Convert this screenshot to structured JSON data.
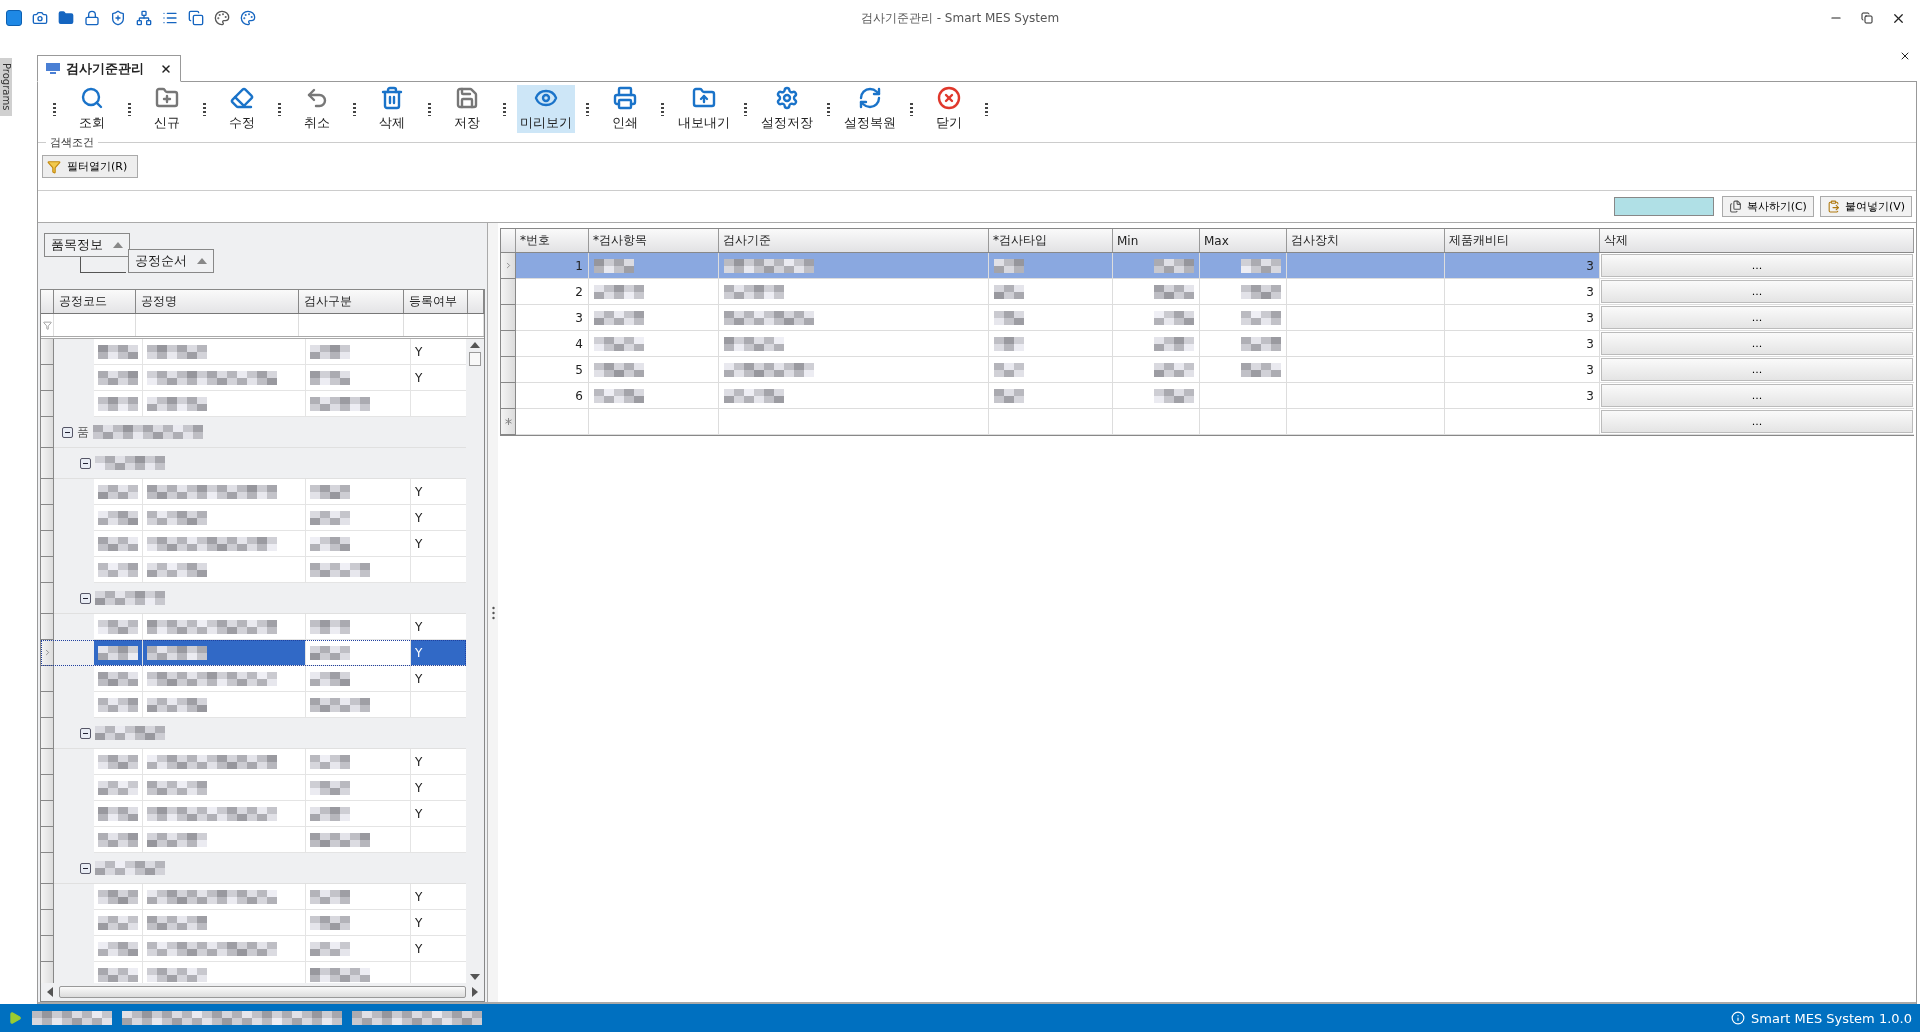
{
  "app_bar": {
    "title": "검사기준관리 - Smart MES System"
  },
  "side_tab": {
    "label": "Programs"
  },
  "document_tab": {
    "label": "검사기준관리",
    "selected": true
  },
  "toolbar": [
    {
      "kind": "search",
      "label": "조회",
      "selected": false
    },
    {
      "kind": "new",
      "label": "신규",
      "selected": false
    },
    {
      "kind": "edit",
      "label": "수정",
      "selected": false
    },
    {
      "kind": "cancel",
      "label": "취소",
      "selected": false
    },
    {
      "kind": "delete",
      "label": "삭제",
      "selected": false
    },
    {
      "kind": "save",
      "label": "저장",
      "selected": false
    },
    {
      "kind": "preview",
      "label": "미리보기",
      "selected": true
    },
    {
      "kind": "print",
      "label": "인쇄",
      "selected": false
    },
    {
      "kind": "export",
      "label": "내보내기",
      "selected": false
    },
    {
      "kind": "settings-save",
      "label": "설정저장",
      "selected": false
    },
    {
      "kind": "settings-restore",
      "label": "설정복원",
      "selected": false
    },
    {
      "kind": "close",
      "label": "닫기",
      "selected": false
    }
  ],
  "search_panel": {
    "title": "검색조건",
    "filter_button": "필터열기(R)"
  },
  "clipboard": {
    "copy": "복사하기(C)",
    "paste": "붙여넣기(V)"
  },
  "left_grid": {
    "group_chips": [
      "품목정보",
      "공정순서"
    ],
    "columns": [
      "공정코드",
      "공정명",
      "검사구분",
      "등록여부"
    ],
    "rows": [
      {
        "kind": "row",
        "registered": "Y",
        "selected": false
      },
      {
        "kind": "row",
        "registered": "Y",
        "selected": false
      },
      {
        "kind": "row",
        "selected": false
      },
      {
        "kind": "group",
        "label": "품",
        "expanded": true
      },
      {
        "kind": "subgroup",
        "expanded": true
      },
      {
        "kind": "row",
        "registered": "Y",
        "selected": false
      },
      {
        "kind": "row",
        "registered": "Y",
        "selected": false
      },
      {
        "kind": "row",
        "registered": "Y",
        "selected": false
      },
      {
        "kind": "row",
        "selected": false
      },
      {
        "kind": "subgroup",
        "expanded": true
      },
      {
        "kind": "row",
        "registered": "Y",
        "selected": false
      },
      {
        "kind": "row",
        "registered": "Y",
        "selected": true
      },
      {
        "kind": "row",
        "registered": "Y",
        "selected": false
      },
      {
        "kind": "row",
        "selected": false
      },
      {
        "kind": "subgroup",
        "expanded": true
      },
      {
        "kind": "row",
        "registered": "Y",
        "selected": false
      },
      {
        "kind": "row",
        "registered": "Y",
        "selected": false
      },
      {
        "kind": "row",
        "registered": "Y",
        "selected": false
      },
      {
        "kind": "row",
        "selected": false
      },
      {
        "kind": "subgroup",
        "expanded": true
      },
      {
        "kind": "row",
        "registered": "Y",
        "selected": false
      },
      {
        "kind": "row",
        "registered": "Y",
        "selected": false
      },
      {
        "kind": "row",
        "registered": "Y",
        "selected": false
      },
      {
        "kind": "row",
        "selected": false
      }
    ]
  },
  "right_grid": {
    "columns": [
      "*번호",
      "*검사항목",
      "검사기준",
      "*검사타입",
      "Min",
      "Max",
      "검사장치",
      "제품캐비티",
      "삭제"
    ],
    "rows": [
      {
        "number": "1",
        "cavity": "3",
        "action": "...",
        "selected": true
      },
      {
        "number": "2",
        "cavity": "3",
        "action": "...",
        "selected": false
      },
      {
        "number": "3",
        "cavity": "3",
        "action": "...",
        "selected": false
      },
      {
        "number": "4",
        "cavity": "3",
        "action": "...",
        "selected": false
      },
      {
        "number": "5",
        "cavity": "3",
        "action": "...",
        "selected": false
      },
      {
        "number": "6",
        "cavity": "3",
        "action": "...",
        "selected": false
      }
    ],
    "new_row": {
      "action": "..."
    }
  },
  "status_bar": {
    "version": "Smart MES System 1.0.0"
  }
}
